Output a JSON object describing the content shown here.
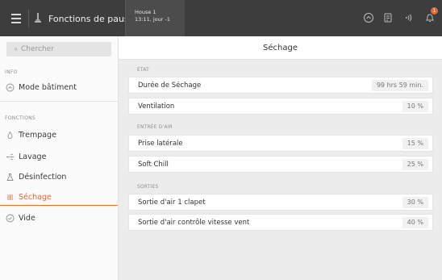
{
  "topbar": {
    "title": "Fonctions de pause",
    "house_name": "House 1",
    "house_time": "13:11, jour -1",
    "notification_count": "1"
  },
  "sidebar": {
    "search_placeholder": "Chercher",
    "info_label": "INFO",
    "functions_label": "FONCTIONS",
    "items": [
      {
        "label": "Mode bâtiment",
        "icon": "house-icon"
      },
      {
        "label": "Trempage",
        "icon": "drop-icon"
      },
      {
        "label": "Lavage",
        "icon": "spray-icon"
      },
      {
        "label": "Désinfection",
        "icon": "flask-icon"
      },
      {
        "label": "Séchage",
        "icon": "heat-icon",
        "active": true
      },
      {
        "label": "Vide",
        "icon": "check-circle-icon"
      }
    ]
  },
  "main": {
    "title": "Séchage",
    "groups": [
      {
        "label": "ÉTAT",
        "rows": [
          {
            "label": "Durée de Séchage",
            "value": "99 hrs 59 min."
          },
          {
            "label": "Ventilation",
            "value": "10 %"
          }
        ]
      },
      {
        "label": "ENTRÉE D'AIR",
        "rows": [
          {
            "label": "Prise latérale",
            "value": "15 %"
          },
          {
            "label": "Soft Chill",
            "value": "25 %"
          }
        ]
      },
      {
        "label": "SORTIES",
        "rows": [
          {
            "label": "Sortie d'air 1 clapet",
            "value": "30 %"
          },
          {
            "label": "Sortie d'air contrôle vitesse vent",
            "value": "40 %"
          }
        ]
      }
    ]
  },
  "colors": {
    "accent": "#e6692e",
    "topbar": "#3d3d3d",
    "background": "#ececec"
  }
}
